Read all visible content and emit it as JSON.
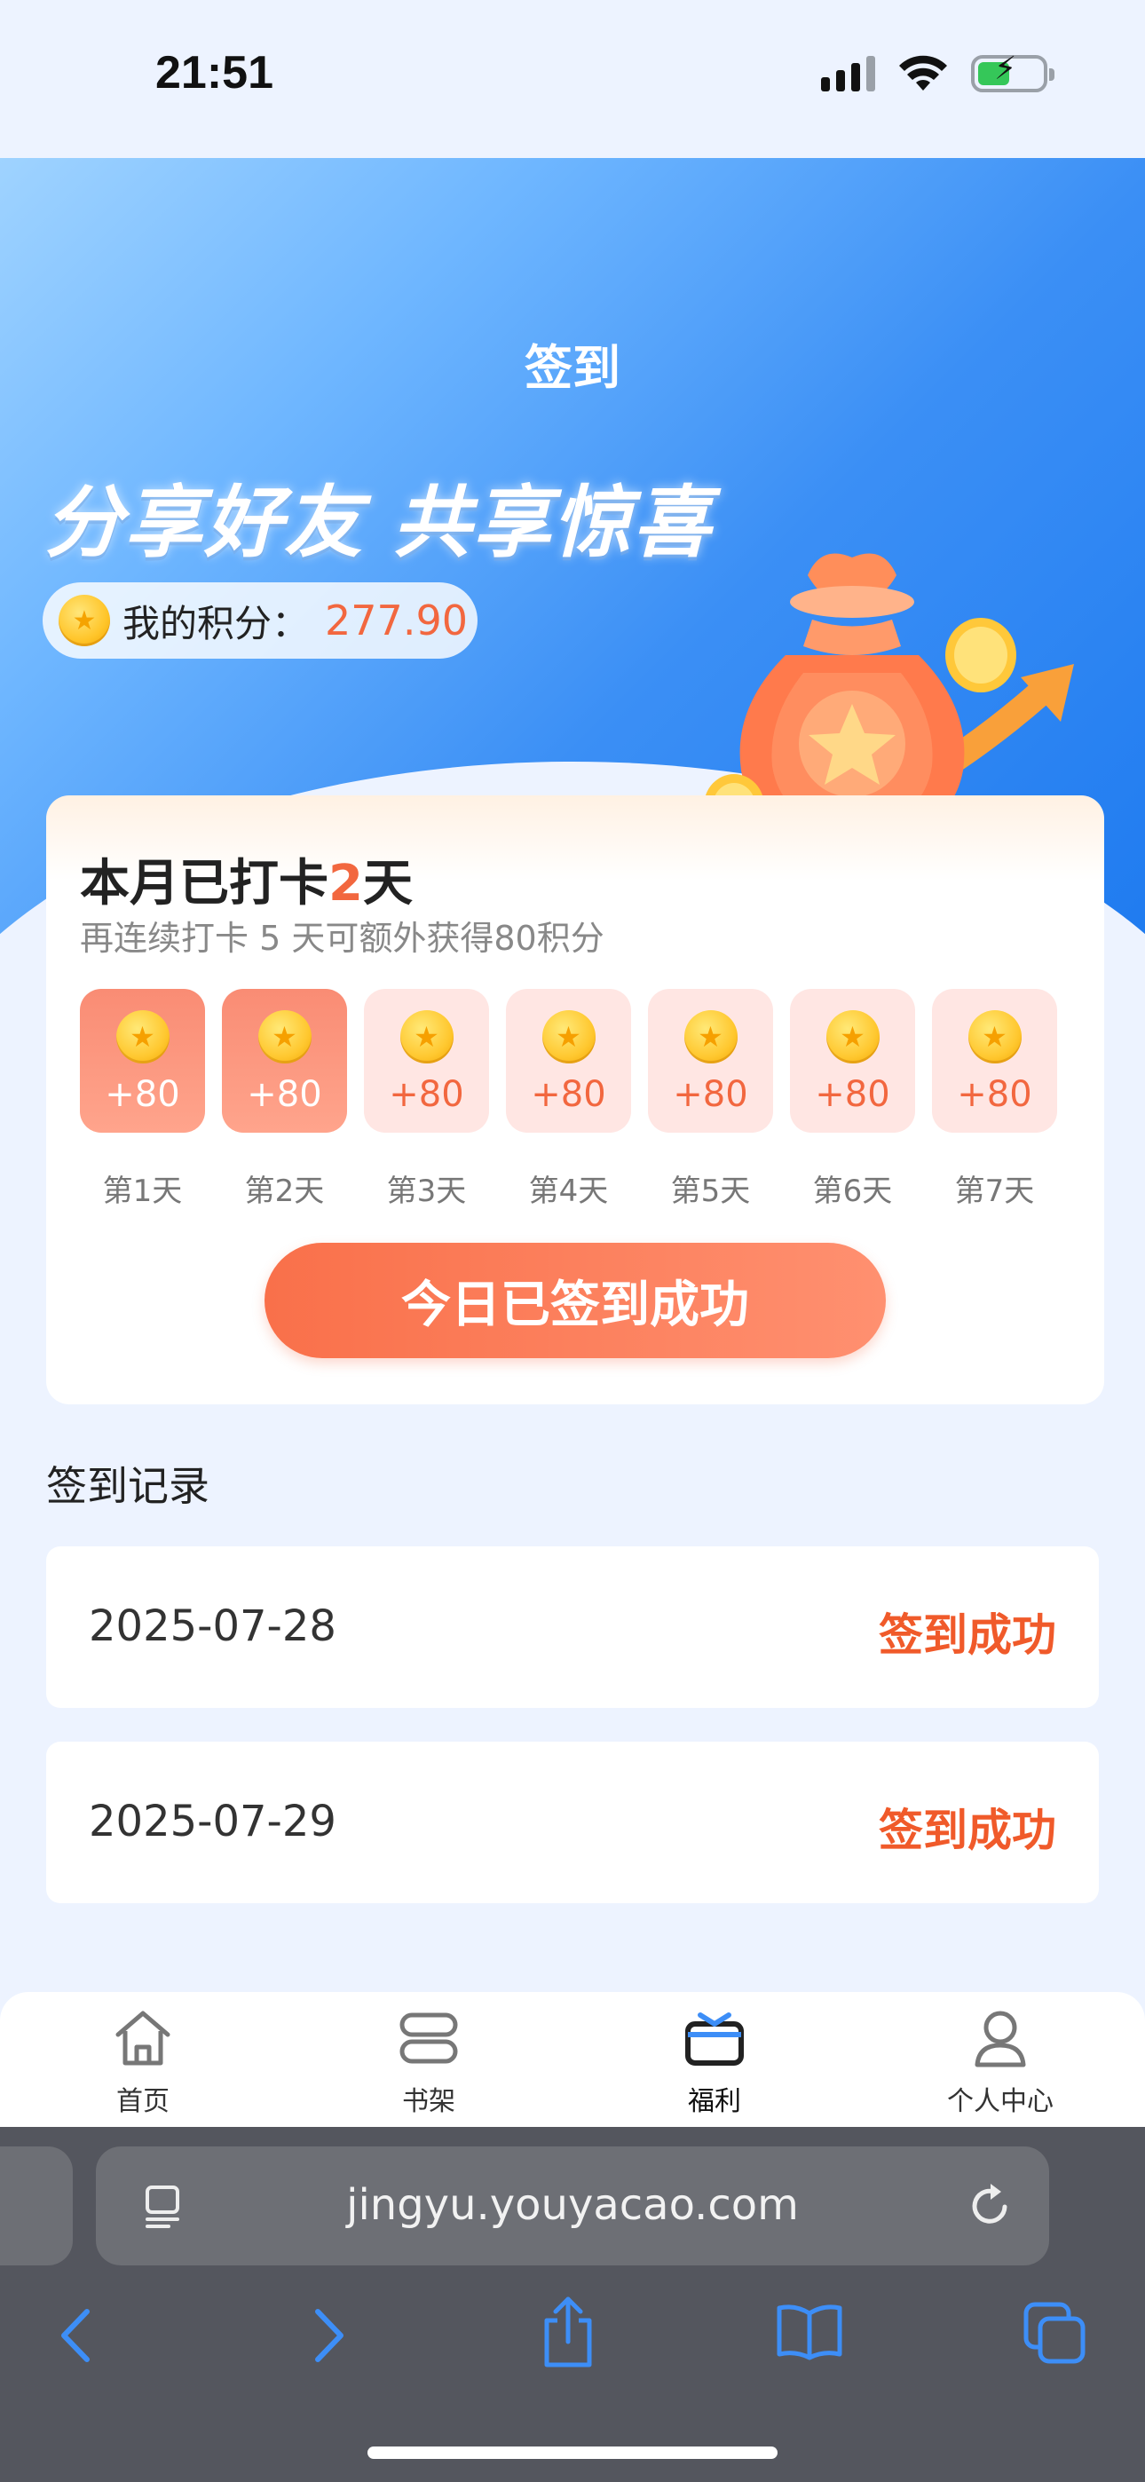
{
  "status_bar": {
    "time": "21:51"
  },
  "header": {
    "title": "签到"
  },
  "banner": {
    "slogan": "分享好友 共享惊喜",
    "points_label": "我的积分：",
    "points_value": "277.90"
  },
  "checkin": {
    "title_prefix": "本月已打卡",
    "days_count": "2",
    "title_suffix": "天",
    "subtitle": "再连续打卡 5 天可额外获得80积分",
    "days": [
      {
        "label": "第1天",
        "points": "+80",
        "checked": true
      },
      {
        "label": "第2天",
        "points": "+80",
        "checked": true
      },
      {
        "label": "第3天",
        "points": "+80",
        "checked": false
      },
      {
        "label": "第4天",
        "points": "+80",
        "checked": false
      },
      {
        "label": "第5天",
        "points": "+80",
        "checked": false
      },
      {
        "label": "第6天",
        "points": "+80",
        "checked": false
      },
      {
        "label": "第7天",
        "points": "+80",
        "checked": false
      }
    ],
    "button_label": "今日已签到成功"
  },
  "records": {
    "title": "签到记录",
    "items": [
      {
        "date": "2025-07-28",
        "status": "签到成功"
      },
      {
        "date": "2025-07-29",
        "status": "签到成功"
      }
    ]
  },
  "tab_bar": {
    "items": [
      {
        "label": "首页",
        "icon": "home-icon",
        "active": false
      },
      {
        "label": "书架",
        "icon": "bookshelf-icon",
        "active": false
      },
      {
        "label": "福利",
        "icon": "gift-icon",
        "active": true
      },
      {
        "label": "个人中心",
        "icon": "user-icon",
        "active": false
      }
    ]
  },
  "browser": {
    "url": "jingyu.youyacao.com"
  },
  "colors": {
    "accent": "#F2673F",
    "banner_blue": "#1F7BF0",
    "safari_toolbar": "#54565E",
    "safari_icon": "#3D8EF7"
  }
}
